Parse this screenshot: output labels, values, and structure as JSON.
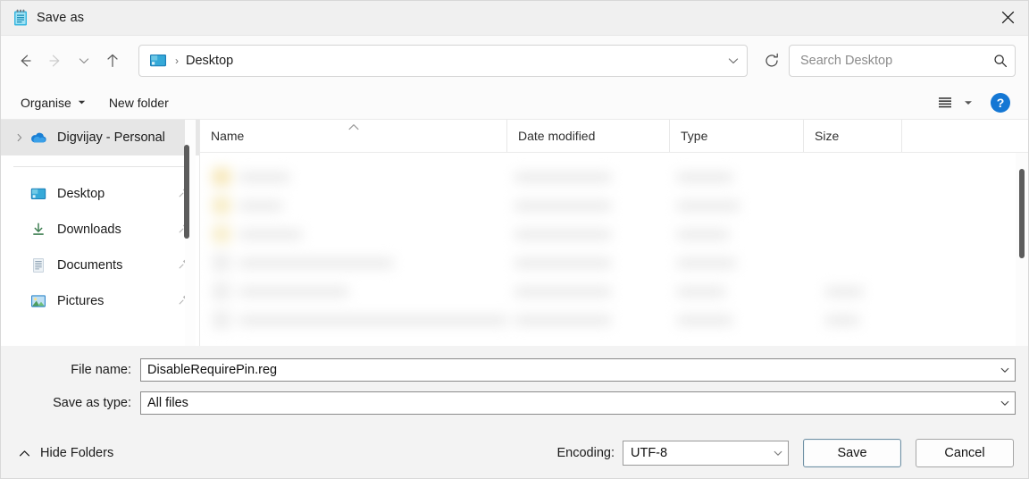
{
  "window": {
    "title": "Save as",
    "icon": "notepad-document-icon",
    "close_label": "Close"
  },
  "nav": {
    "back_icon": "arrow-left-icon",
    "forward_icon": "arrow-right-icon",
    "recent_icon": "chevron-down-icon",
    "up_icon": "arrow-up-icon",
    "address": {
      "folder_icon": "desktop-folder-icon",
      "separator": "›",
      "crumb": "Desktop",
      "dropdown_icon": "chevron-down-icon"
    },
    "refresh_icon": "refresh-icon",
    "search": {
      "placeholder": "Search Desktop",
      "icon": "search-icon"
    }
  },
  "commandbar": {
    "organise_label": "Organise",
    "organise_caret": "caret-down-icon",
    "new_folder_label": "New folder",
    "view_icon": "view-list-icon",
    "view_caret": "chevron-down-icon",
    "help_label": "?",
    "help_icon": "help-circle-icon"
  },
  "sidebar": {
    "items": [
      {
        "label": "Digvijay - Personal",
        "icon": "onedrive-cloud-icon",
        "expandable": true,
        "selected": true,
        "pinned": false,
        "indent": 0
      },
      {
        "label": "Desktop",
        "icon": "desktop-icon",
        "expandable": false,
        "selected": false,
        "pinned": true,
        "indent": 1
      },
      {
        "label": "Downloads",
        "icon": "downloads-icon",
        "expandable": false,
        "selected": false,
        "pinned": true,
        "indent": 1
      },
      {
        "label": "Documents",
        "icon": "documents-icon",
        "expandable": false,
        "selected": false,
        "pinned": true,
        "indent": 1
      },
      {
        "label": "Pictures",
        "icon": "pictures-icon",
        "expandable": false,
        "selected": false,
        "pinned": true,
        "indent": 1
      }
    ]
  },
  "filelist": {
    "columns": [
      {
        "label": "Name",
        "sorted": "ascending",
        "sort_icon": "caret-up-icon"
      },
      {
        "label": "Date modified",
        "sorted": "",
        "sort_icon": ""
      },
      {
        "label": "Type",
        "sorted": "",
        "sort_icon": ""
      },
      {
        "label": "Size",
        "sorted": "",
        "sort_icon": ""
      }
    ],
    "content_state": "blurred",
    "rows": []
  },
  "form": {
    "file_name_label": "File name:",
    "file_name_value": "DisableRequirePin.reg",
    "save_as_type_label": "Save as type:",
    "save_as_type_value": "All files",
    "dropdown_icon": "chevron-down-icon"
  },
  "footer": {
    "hide_folders_label": "Hide Folders",
    "hide_folders_icon": "chevron-up-icon",
    "encoding_label": "Encoding:",
    "encoding_value": "UTF-8",
    "encoding_dropdown_icon": "chevron-down-icon",
    "save_label": "Save",
    "cancel_label": "Cancel"
  },
  "colors": {
    "accent": "#1477d4",
    "titlebar_bg": "#f0f0f0",
    "dialog_bg": "#f3f3f3",
    "selection_bg": "#e6e6e6",
    "text": "#1b1b1b"
  }
}
